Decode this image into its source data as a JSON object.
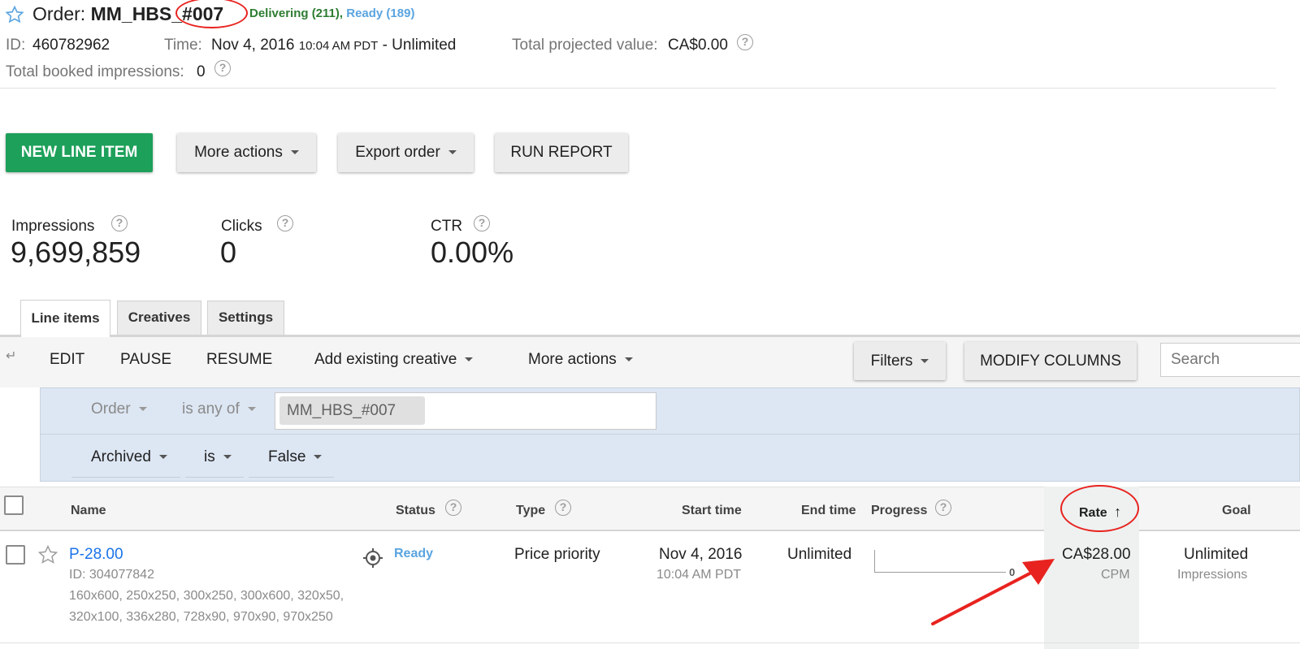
{
  "order": {
    "title_prefix": "Order: ",
    "name_part": "MM_HBS_",
    "name_highlight": "#007",
    "delivering": "Delivering (211)",
    "separator": ",",
    "ready": "Ready (189)",
    "id_label": "ID:",
    "id_value": "460782962",
    "time_label": "Time:",
    "time_date": "Nov 4, 2016",
    "time_clock": "10:04 AM PDT",
    "time_end": "- Unlimited",
    "projected_label": "Total projected value:",
    "projected_value": "CA$0.00",
    "booked_label": "Total booked impressions:",
    "booked_value": "0"
  },
  "actions": {
    "new_line_item": "NEW LINE ITEM",
    "more_actions": "More actions",
    "export_order": "Export order",
    "run_report": "RUN REPORT"
  },
  "stats": {
    "impressions_label": "Impressions",
    "impressions_value": "9,699,859",
    "clicks_label": "Clicks",
    "clicks_value": "0",
    "ctr_label": "CTR",
    "ctr_value": "0.00%"
  },
  "tabs": [
    "Line items",
    "Creatives",
    "Settings"
  ],
  "toolbar": {
    "edit": "EDIT",
    "pause": "PAUSE",
    "resume": "RESUME",
    "add_existing_creative": "Add existing creative",
    "more_actions": "More actions",
    "filters": "Filters",
    "modify_columns": "MODIFY COLUMNS",
    "search_placeholder": "Search"
  },
  "filters": {
    "row1": {
      "field": "Order",
      "operator": "is any of",
      "chip": "MM_HBS_#007"
    },
    "row2": {
      "field": "Archived",
      "operator": "is",
      "value": "False"
    }
  },
  "table": {
    "headers": {
      "name": "Name",
      "status": "Status",
      "type": "Type",
      "start_time": "Start time",
      "end_time": "End time",
      "progress": "Progress",
      "rate": "Rate",
      "goal": "Goal"
    },
    "rows": [
      {
        "name": "P-28.00",
        "id": "ID: 304077842",
        "sizes_line1": "160x600, 250x250, 300x250, 300x600, 320x50,",
        "sizes_line2": "320x100, 336x280, 728x90, 970x90, 970x250",
        "status": "Ready",
        "type": "Price priority",
        "start_date": "Nov 4, 2016",
        "start_clock": "10:04 AM PDT",
        "end_time": "Unlimited",
        "progress_value": "0",
        "rate": "CA$28.00",
        "rate_unit": "CPM",
        "goal": "Unlimited",
        "goal_unit": "Impressions"
      }
    ]
  },
  "colors": {
    "green": "#1da05a",
    "delivering": "#2e7d32",
    "ready": "#5aa4e0",
    "link": "#1a73e8",
    "annotation_red": "#e8231f",
    "filter_bg": "#dde6f3"
  },
  "icons": [
    "star-icon",
    "help-icon",
    "caret-down-icon",
    "arrow-up-icon",
    "target-icon",
    "collapse-arrow-icon"
  ]
}
